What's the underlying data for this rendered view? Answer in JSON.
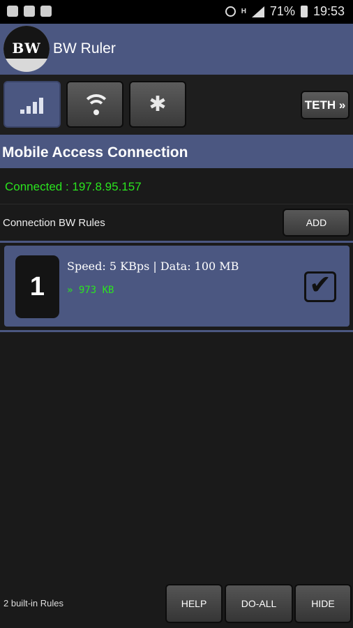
{
  "status_bar": {
    "battery": "71%",
    "time": "19:53",
    "network_type": "H"
  },
  "app": {
    "title": "BW Ruler",
    "logo_text": "BW"
  },
  "tabs": [
    {
      "name": "mobile",
      "icon": "signal-bars-icon",
      "active": true
    },
    {
      "name": "wifi",
      "icon": "wifi-icon",
      "active": false
    },
    {
      "name": "bluetooth",
      "icon": "bluetooth-icon",
      "symbol": "✱",
      "active": false
    }
  ],
  "teth_button": {
    "label": "TETH »"
  },
  "section": {
    "title": "Mobile Access Connection",
    "connection_status": "Connected : 197.8.95.157"
  },
  "rules_header": {
    "label": "Connection BW Rules",
    "add_label": "ADD"
  },
  "rules": [
    {
      "number": "1",
      "description": "Speed: 5 KBps | Data: 100 MB",
      "usage": "» 973 KB",
      "checked": true,
      "check_glyph": "✔"
    }
  ],
  "footer": {
    "builtin_label": "2 built-in Rules",
    "help_label": "HELP",
    "doall_label": "DO-ALL",
    "hide_label": "HIDE"
  },
  "colors": {
    "accent": "#4b5781",
    "background": "#1a1a1a",
    "status_green": "#2be41f"
  }
}
